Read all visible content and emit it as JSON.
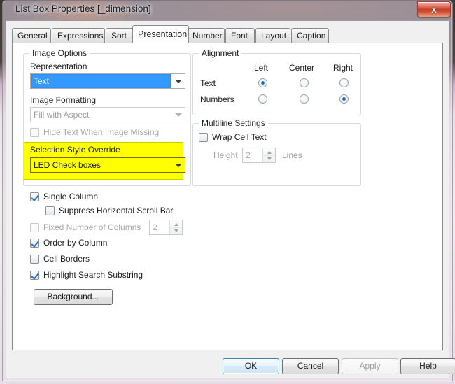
{
  "window": {
    "title": "List Box Properties [_dimension]",
    "close_label": "x"
  },
  "tabs": [
    {
      "label": "General",
      "active": false
    },
    {
      "label": "Expressions",
      "active": false
    },
    {
      "label": "Sort",
      "active": false
    },
    {
      "label": "Presentation",
      "active": true
    },
    {
      "label": "Number",
      "active": false
    },
    {
      "label": "Font",
      "active": false
    },
    {
      "label": "Layout",
      "active": false
    },
    {
      "label": "Caption",
      "active": false
    }
  ],
  "image_options": {
    "group_title": "Image Options",
    "representation_label": "Representation",
    "representation_value": "Text",
    "image_formatting_label": "Image Formatting",
    "image_formatting_value": "Fill with Aspect",
    "hide_text_label": "Hide Text When Image Missing",
    "selection_style_label": "Selection Style Override",
    "selection_style_value": "LED Check boxes",
    "highlight_color": "#ffff00"
  },
  "alignment": {
    "group_title": "Alignment",
    "col_left": "Left",
    "col_center": "Center",
    "col_right": "Right",
    "row_text": "Text",
    "row_numbers": "Numbers",
    "text_selection": "Left",
    "numbers_selection": "Right"
  },
  "multiline": {
    "group_title": "Multiline Settings",
    "wrap_cell_text_label": "Wrap Cell Text",
    "height_label": "Height",
    "height_value": "2",
    "lines_label": "Lines"
  },
  "column_options": {
    "single_column_label": "Single Column",
    "suppress_scroll_label": "Suppress Horizontal Scroll Bar",
    "fixed_columns_label": "Fixed Number of Columns",
    "fixed_columns_value": "2",
    "order_by_column_label": "Order by Column",
    "cell_borders_label": "Cell Borders",
    "highlight_search_label": "Highlight Search Substring",
    "background_button": "Background..."
  },
  "footer": {
    "ok": "OK",
    "cancel": "Cancel",
    "apply": "Apply",
    "help": "Help"
  }
}
